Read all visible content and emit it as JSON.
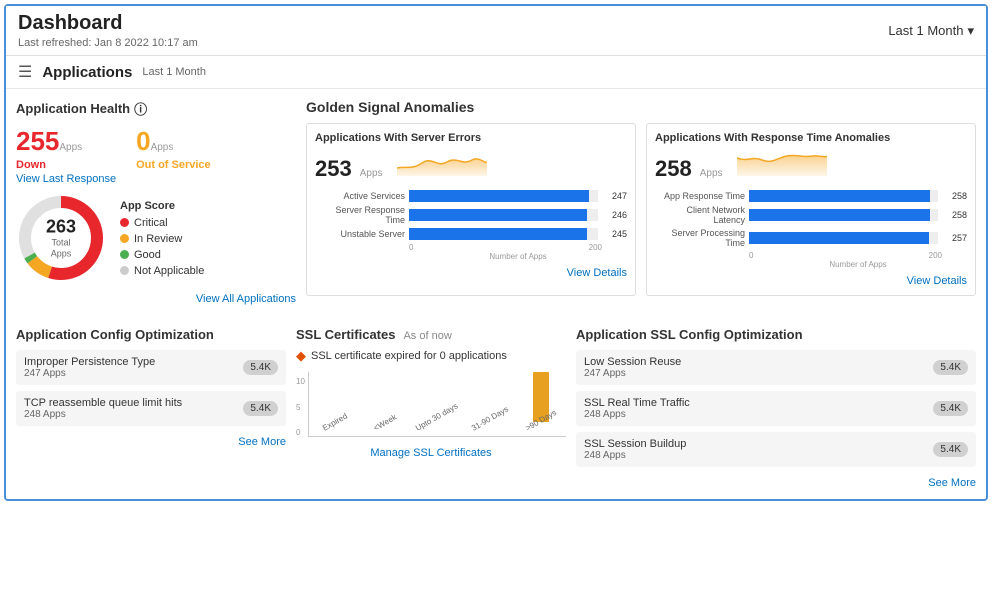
{
  "header": {
    "title": "Dashboard",
    "last_refreshed": "Last refreshed: Jan 8 2022 10:17 am",
    "time_filter": "Last 1 Month",
    "chevron": "▾"
  },
  "section": {
    "icon": "☰",
    "title": "Applications",
    "badge": "Last 1 Month"
  },
  "app_health": {
    "title": "Application Health",
    "info_icon": "ⓘ",
    "down_count": "255",
    "down_label": "Apps",
    "oos_count": "0",
    "oos_label": "Apps",
    "down_text": "Down",
    "oos_text": "Out of Service",
    "view_response": "View Last Response",
    "donut": {
      "total": "263",
      "label": "Total",
      "sub": "Apps"
    },
    "legend": [
      {
        "color": "#e8272d",
        "label": "Critical"
      },
      {
        "color": "#f5a623",
        "label": "In Review"
      },
      {
        "color": "#4caf50",
        "label": "Good"
      },
      {
        "color": "#cccccc",
        "label": "Not Applicable"
      }
    ],
    "legend_title": "App Score",
    "view_all": "View All Applications"
  },
  "golden_signals": {
    "title": "Golden Signal Anomalies",
    "cards": [
      {
        "title": "Applications With Server Errors",
        "count": "253",
        "count_label": "Apps",
        "bars": [
          {
            "label": "Active Services",
            "value": 247,
            "max": 260
          },
          {
            "label": "Server Response Time",
            "value": 246,
            "max": 260
          },
          {
            "label": "Unstable Server",
            "value": 245,
            "max": 260
          }
        ],
        "axis_start": "0",
        "axis_mid": "200",
        "axis_label": "Number of Apps",
        "view_details": "View Details"
      },
      {
        "title": "Applications With Response Time Anomalies",
        "count": "258",
        "count_label": "Apps",
        "bars": [
          {
            "label": "App Response Time",
            "value": 258,
            "max": 270
          },
          {
            "label": "Client Network Latency",
            "value": 258,
            "max": 270
          },
          {
            "label": "Server Processing Time",
            "value": 257,
            "max": 270
          }
        ],
        "axis_start": "0",
        "axis_mid": "200",
        "axis_label": "Number of Apps",
        "view_details": "View Details"
      }
    ]
  },
  "app_config": {
    "title": "Application Config Optimization",
    "items": [
      {
        "name": "Improper Persistence Type",
        "sub": "247 Apps",
        "badge": "5.4K"
      },
      {
        "name": "TCP reassemble queue limit hits",
        "sub": "248 Apps",
        "badge": "5.4K"
      }
    ],
    "see_more": "See More"
  },
  "ssl_certs": {
    "title": "SSL Certificates",
    "sub": "As of now",
    "alert": "SSL certificate expired for 0 applications",
    "bars": [
      {
        "label": "Expired",
        "value": 0
      },
      {
        "label": "<Week",
        "value": 0
      },
      {
        "label": "Upto 30 days",
        "value": 0
      },
      {
        "label": "31-90 Days",
        "value": 0
      },
      {
        "label": ">90 Days",
        "value": 8
      }
    ],
    "y_axis": [
      "10",
      "5",
      "0"
    ],
    "manage_link": "Manage SSL Certificates"
  },
  "ssl_config": {
    "title": "Application SSL Config Optimization",
    "items": [
      {
        "name": "Low Session Reuse",
        "sub": "247 Apps",
        "badge": "5.4K"
      },
      {
        "name": "SSL Real Time Traffic",
        "sub": "248 Apps",
        "badge": "5.4K"
      },
      {
        "name": "SSL Session Buildup",
        "sub": "248 Apps",
        "badge": "5.4K"
      }
    ],
    "see_more": "See More"
  }
}
